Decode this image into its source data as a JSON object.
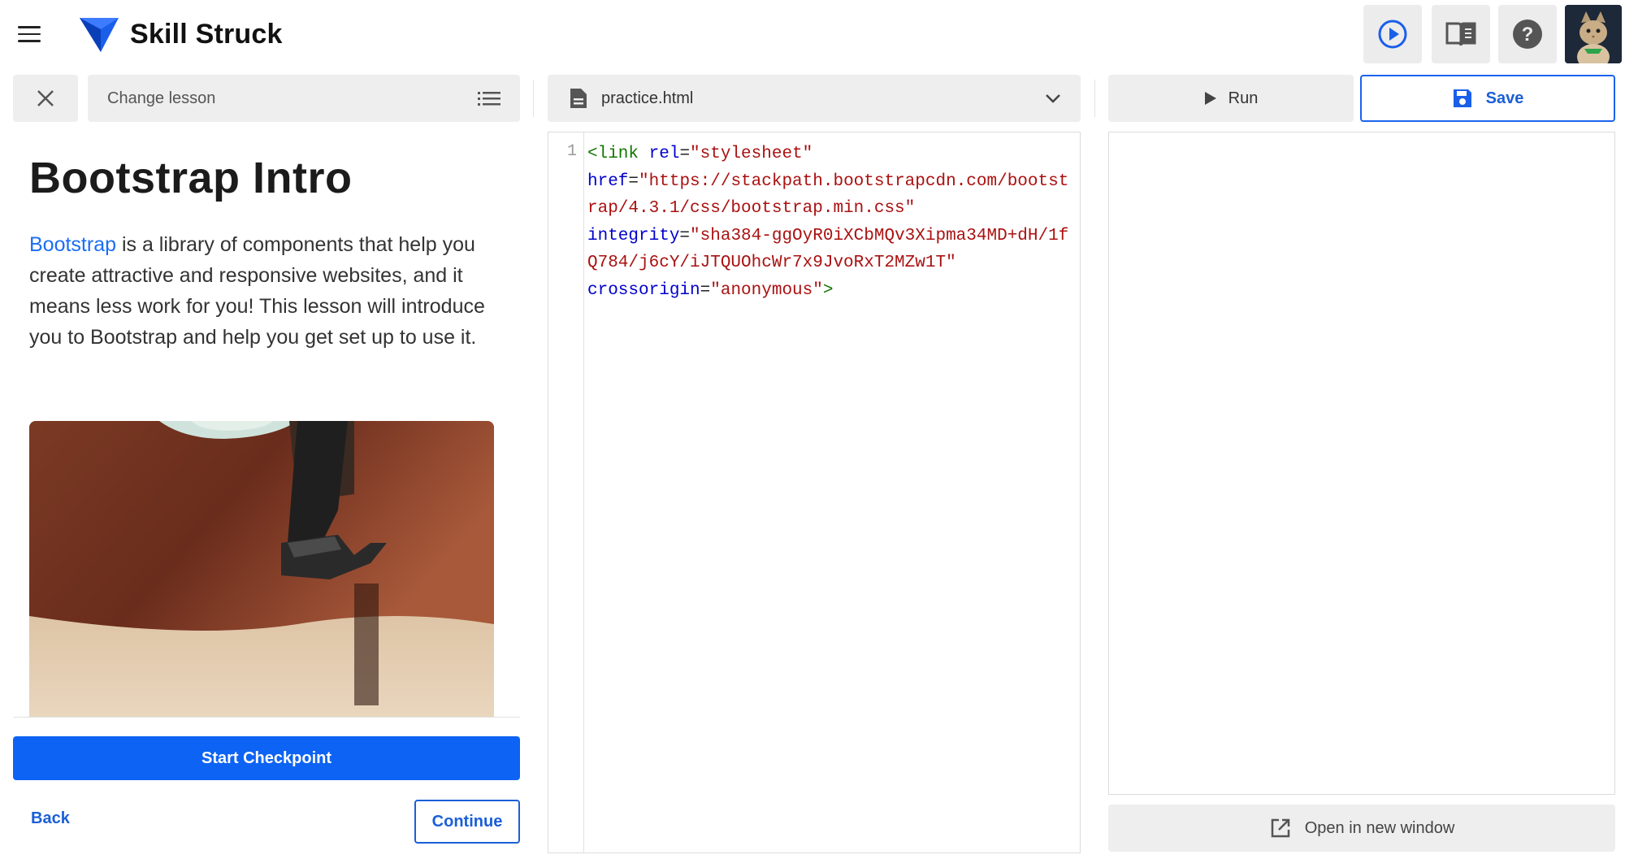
{
  "app": {
    "brand": "Skill Struck",
    "brand_color": "#1a5fea"
  },
  "topbar": {
    "icons": [
      "menu-icon",
      "play-circle-icon",
      "book-icon",
      "help-icon",
      "avatar"
    ]
  },
  "lesson": {
    "change_lesson_label": "Change lesson",
    "title": "Bootstrap Intro",
    "link_text": "Bootstrap",
    "paragraph_rest": " is a library of components that help you create attractive and responsive websites, and it means less work for you! This lesson will introduce you to Bootstrap and help you get set up to use it.",
    "start_checkpoint": "Start Checkpoint",
    "back": "Back",
    "continue": "Continue"
  },
  "editor": {
    "file_name": "practice.html",
    "line_number": "1",
    "code": {
      "tag_open": "<link",
      "attr_rel": "rel",
      "val_rel": "\"stylesheet\"",
      "attr_href": "href",
      "val_href": "\"https://stackpath.bootstrapcdn.com/bootstrap/4.3.1/css/bootstrap.min.css\"",
      "attr_integrity": "integrity",
      "val_integrity": "\"sha384-ggOyR0iXCbMQv3Xipma34MD+dH/1fQ784/j6cY/iJTQUOhcWr7x9JvoRxT2MZw1T\"",
      "attr_crossorigin": "crossorigin",
      "val_crossorigin": "\"anonymous\"",
      "tag_close": ">",
      "equals": "="
    }
  },
  "preview": {
    "run": "Run",
    "save": "Save",
    "open_new_window": "Open in new window"
  }
}
